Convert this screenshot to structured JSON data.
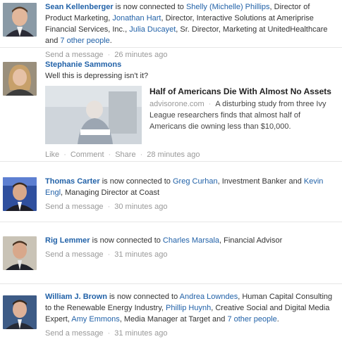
{
  "feed": [
    {
      "name": "Sean Kellenberger",
      "verb": " is now connected to ",
      "p1_name": "Shelly (Michelle) Phillips",
      "p1_title": ", Director of Product Marketing, ",
      "p2_name": "Jonathan Hart",
      "p2_title": ", Director, Interactive Solutions at Ameriprise Financial Services, Inc., ",
      "p3_name": "Julia Ducayet",
      "p3_title": ", Sr. Director, Marketing at UnitedHealthcare and ",
      "others": "7 other people",
      "end": ".",
      "action": "Send a message",
      "time": "26 minutes ago"
    },
    {
      "name": "Stephanie Sammons",
      "message": "Well this is depressing isn't it?",
      "article_title": "Half of Americans Die With Almost No Assets",
      "article_source": "advisorone.com",
      "article_desc": "A disturbing study from three Ivy League researchers finds that almost half of Americans die owning less than $10,000.",
      "like": "Like",
      "comment": "Comment",
      "share": "Share",
      "time": "28 minutes ago"
    },
    {
      "name": "Thomas Carter",
      "verb": " is now connected to ",
      "p1_name": "Greg Curhan",
      "p1_title": ", Investment Banker and ",
      "p2_name": "Kevin Engl",
      "p2_title": ", Managing Director at Coast",
      "action": "Send a message",
      "time": "30 minutes ago"
    },
    {
      "name": "Rig Lemmer",
      "verb": " is now connected to ",
      "p1_name": "Charles Marsala",
      "p1_title": ", Financial Advisor",
      "action": "Send a message",
      "time": "31 minutes ago"
    },
    {
      "name": "William J. Brown",
      "verb": " is now connected to ",
      "p1_name": "Andrea Lowndes",
      "p1_title": ", Human Capital Consulting to the Renewable Energy Industry, ",
      "p2_name": "Phillip Huynh",
      "p2_title": ", Creative Social and Digital Media Expert, ",
      "p3_name": "Amy Emmons",
      "p3_title": ", Media Manager at Target and ",
      "others": "7 other people",
      "end": ".",
      "action": "Send a message",
      "time": "31 minutes ago"
    }
  ],
  "colors": {
    "link": "#2262a8",
    "meta": "#999999",
    "divider": "#e6e6e6"
  }
}
